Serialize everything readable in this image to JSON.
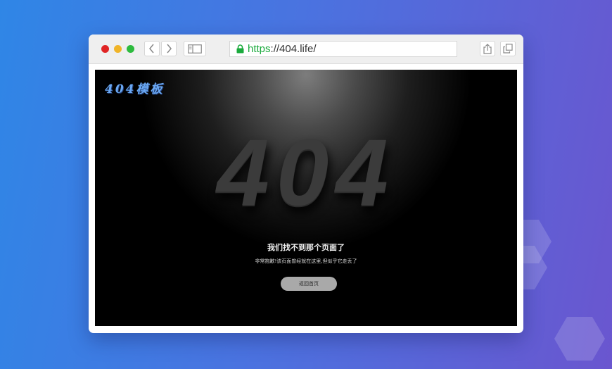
{
  "browser": {
    "url_scheme": "https",
    "url_rest": "://404.life/",
    "traffic_light_colors": [
      "#e02424",
      "#f0b428",
      "#2dbb3e"
    ],
    "url_secure_color": "#1aaa3c"
  },
  "icons": {
    "back": "chevron-left-icon",
    "forward": "chevron-right-icon",
    "sidebar": "sidebar-icon",
    "lock": "lock-icon",
    "share": "share-icon",
    "tabs": "tabs-icon"
  },
  "page": {
    "logo": "404模板",
    "big_code": "404",
    "headline": "我们找不到那个页面了",
    "subline": "非常抱歉!该页面曾经就在这里,但似乎它走丢了",
    "home_button": "返回首页",
    "logo_color": "#6aa8f3"
  }
}
